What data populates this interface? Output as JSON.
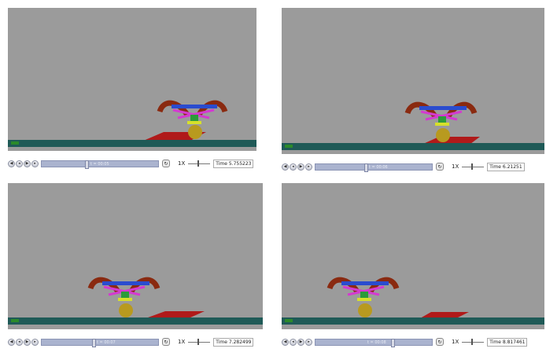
{
  "panels": [
    {
      "speed_label": "1X",
      "time_text": "Time 5.755223",
      "slider_label": "t = 00:05"
    },
    {
      "speed_label": "1X",
      "time_text": "Time 6.21251",
      "slider_label": "t = 00:06"
    },
    {
      "speed_label": "1X",
      "time_text": "Time 7.282499",
      "slider_label": "t = 00:07"
    },
    {
      "speed_label": "1X",
      "time_text": "Time 8.817461",
      "slider_label": "t = 00:08"
    }
  ],
  "controls": {
    "rewind_icon": "skip-back-icon",
    "step_back_icon": "step-back-icon",
    "play_icon": "play-icon",
    "forward_icon": "skip-forward-icon",
    "loop_icon": "loop-icon"
  },
  "colors": {
    "viewport_bg": "#9b9b9b",
    "ground": "#1f5a57",
    "ramp": "#b01a1a",
    "ball": "#b89a1f",
    "leg_brown": "#8a2a10"
  }
}
